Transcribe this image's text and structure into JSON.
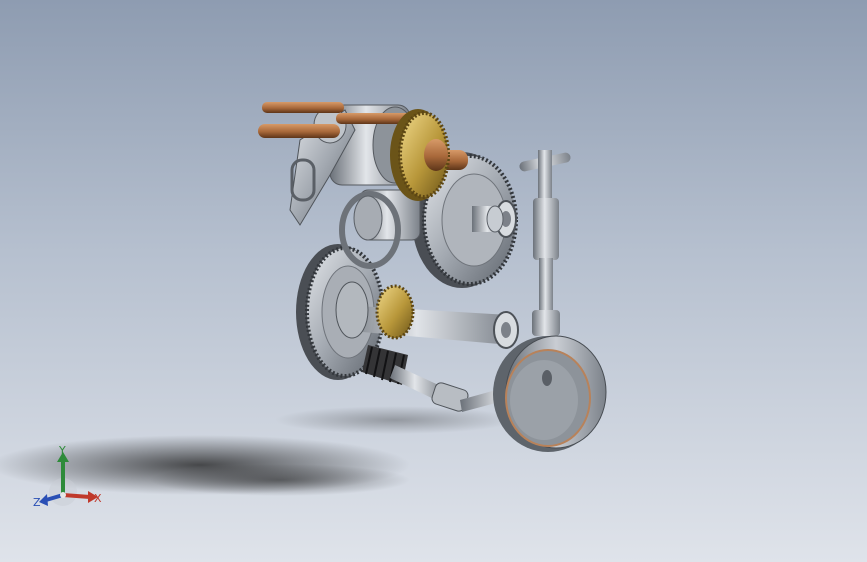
{
  "viewport": {
    "background_top": "#8e9cb1",
    "background_bottom": "#dfe3ea"
  },
  "model": {
    "parts": [
      "spur-gear-large-upper",
      "spur-gear-large-lower",
      "pinion-brass-upper",
      "pinion-brass-lower",
      "worm-gear",
      "handwheel",
      "universal-joint",
      "vertical-post",
      "bearing",
      "copper-shafts",
      "link-arm"
    ],
    "colors": {
      "steel": "#9aa0a8",
      "brass": "#b8973a",
      "copper": "#a8683a",
      "dark": "#3c3c3c",
      "wheel_ring": "#b8825a"
    }
  },
  "triad": {
    "x_label": "X",
    "y_label": "Y",
    "z_label": "Z",
    "x_color": "#c0392b",
    "y_color": "#2e8b3a",
    "z_color": "#2a4fb5"
  }
}
